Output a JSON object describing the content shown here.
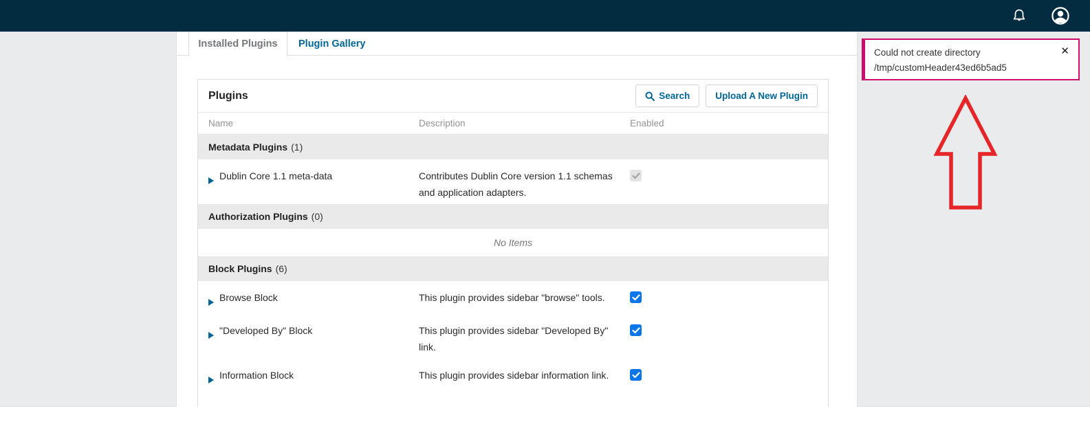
{
  "topbar": {
    "icons": [
      {
        "name": "notification-bell-icon"
      },
      {
        "name": "user-avatar-icon"
      }
    ]
  },
  "tabs": [
    {
      "label": "Installed Plugins",
      "active": true
    },
    {
      "label": "Plugin Gallery",
      "active": false
    }
  ],
  "panel": {
    "title": "Plugins",
    "buttons": {
      "search": "Search",
      "upload": "Upload A New Plugin"
    },
    "columns": [
      "Name",
      "Description",
      "Enabled"
    ],
    "sections": [
      {
        "title": "Metadata Plugins",
        "count": "(1)",
        "rows": [
          {
            "name": "Dublin Core 1.1 meta-data",
            "description": "Contributes Dublin Core version 1.1 schemas and application adapters.",
            "enabled": true,
            "disabled": true
          }
        ]
      },
      {
        "title": "Authorization Plugins",
        "count": "(0)",
        "empty_label": "No Items",
        "rows": []
      },
      {
        "title": "Block Plugins",
        "count": "(6)",
        "rows": [
          {
            "name": "Browse Block",
            "description": "This plugin provides sidebar \"browse\" tools.",
            "enabled": true,
            "disabled": false
          },
          {
            "name": "\"Developed By\" Block",
            "description": "This plugin provides sidebar \"Developed By\" link.",
            "enabled": true,
            "disabled": false
          },
          {
            "name": "Information Block",
            "description": "This plugin provides sidebar information link.",
            "enabled": true,
            "disabled": false
          }
        ]
      }
    ]
  },
  "notification": {
    "message": "Could not create directory /tmp/customHeader43ed6b5ad5",
    "close": "✕"
  },
  "annotation": {
    "shape": "red-up-arrow"
  },
  "colors": {
    "navbar": "#042c40",
    "accent_blue": "#006798",
    "checkbox_blue": "#0b76e8",
    "notification_border": "#cd0c6c",
    "arrow_red": "#e62528",
    "page_gray": "#e9ebed",
    "section_gray": "#eaeaea"
  }
}
